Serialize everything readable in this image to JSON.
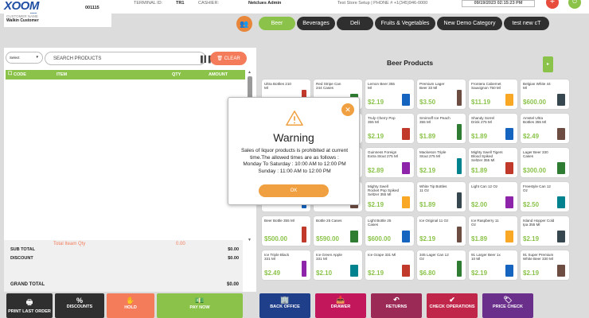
{
  "header": {
    "logo": "XOOM",
    "logo_sub": "POS",
    "register_label": "",
    "register": "001115",
    "terminal_label": "TERMINAL ID:",
    "terminal": "TR1",
    "cashier_label": "CASHIER:",
    "cashier": "Netclues Admin",
    "store": "Test Store Setup | PHONE # +1(345)946-0000",
    "datetime": "09/19/2023 02:15:23 PM"
  },
  "customer": {
    "label": "CUSTOMER NAME",
    "name": "Walkin Customer"
  },
  "categories": [
    {
      "label": "Beer",
      "active": true
    },
    {
      "label": "Beverages",
      "active": false
    },
    {
      "label": "Deli",
      "active": false
    },
    {
      "label": "Fruits & Vegetables",
      "active": false
    },
    {
      "label": "New Demo Category",
      "active": false
    },
    {
      "label": "test new cT",
      "active": false
    }
  ],
  "cart": {
    "select_label": "Select",
    "search_placeholder": "SEARCH PRODUCTS",
    "clear_label": "CLEAR",
    "columns": [
      "CODE",
      "ITEM",
      "QTY",
      "AMOUNT"
    ],
    "total_item_qty_label": "Total Iteam Qty",
    "total_item_qty": "0.00",
    "sub_total_label": "SUB TOTAL",
    "sub_total": "$0.00",
    "discount_label": "DISCOUNT",
    "discount": "$0.00",
    "grand_total_label": "GRAND TOTAL",
    "grand_total": "$0.00"
  },
  "actions": {
    "print_last_order": "PRINT LAST ORDER",
    "discounts": "DISCOUNTS",
    "hold": "HOLD",
    "pay_now": "PAY NOW"
  },
  "products_title": "Beer Products",
  "products": [
    {
      "name": "Ultra Bottles 210 Ml",
      "price": ""
    },
    {
      "name": "Red Stripe Can 244 Cases",
      "price": ""
    },
    {
      "name": "Lemon Beer 355 Ml",
      "price": "$2.19"
    },
    {
      "name": "Premium Lager Beer 33 Ml",
      "price": "$3.50"
    },
    {
      "name": "Frontera Cabernet Sauvignon 750 Ml",
      "price": "$11.19"
    },
    {
      "name": "Belgian White 44 Ml",
      "price": "$600.00"
    },
    {
      "name": "",
      "price": ""
    },
    {
      "name": "",
      "price": ""
    },
    {
      "name": "Truly Cherry Pop 355 Ml",
      "price": "$2.19"
    },
    {
      "name": "Smirnoff Ice Peach 355 Ml",
      "price": "$1.89"
    },
    {
      "name": "Shandy Sorrel Drink 275 Ml",
      "price": "$1.89"
    },
    {
      "name": "Amstel Ultra Bottles 355 Ml",
      "price": "$2.49"
    },
    {
      "name": "",
      "price": ""
    },
    {
      "name": "",
      "price": ""
    },
    {
      "name": "Guinness Foreign Extra Stout 275 Ml",
      "price": "$2.89"
    },
    {
      "name": "Mackeson Triple Stout 275 Ml",
      "price": "$2.19"
    },
    {
      "name": "Mighty Swell Tigers Blood Spiked Seltzer 355 Ml",
      "price": "$1.89"
    },
    {
      "name": "Lager Beer 330 Cases",
      "price": "$300.00"
    },
    {
      "name": "",
      "price": ""
    },
    {
      "name": "",
      "price": ""
    },
    {
      "name": "Mighty Swell Rocket Pop Spiked Seltzer 355 Ml",
      "price": "$2.19"
    },
    {
      "name": "White Tip Bottles 11 Oz",
      "price": "$1.89"
    },
    {
      "name": "Light Can 12 Oz",
      "price": "$2.00"
    },
    {
      "name": "Freestyle Can 12 Oz",
      "price": "$2.50"
    },
    {
      "name": "Beer Bottle 355 Ml",
      "price": "$500.00"
    },
    {
      "name": "Bottle 25 Cases",
      "price": "$590.00"
    },
    {
      "name": "Light Bottle 25 Cases",
      "price": "$600.00"
    },
    {
      "name": "Ice Original 11 Oz",
      "price": "$2.19"
    },
    {
      "name": "Ice Raspberry 11 Oz",
      "price": "$1.89"
    },
    {
      "name": "Island Hopper Cold Ipa 355 Ml",
      "price": "$2.19"
    },
    {
      "name": "Ice Triple Black 331 Ml",
      "price": "$2.49"
    },
    {
      "name": "Ice Green Apple 331 Ml",
      "price": "$2.10"
    },
    {
      "name": "Ice Grape 331 Ml",
      "price": "$2.19"
    },
    {
      "name": "345 Lager Can 12 Oz",
      "price": "$6.80"
    },
    {
      "name": "91 Larger Beer 1x 10 Ml",
      "price": "$2.19"
    },
    {
      "name": "91 Super Premium White Beer 330 Ml",
      "price": "$2.19"
    }
  ],
  "bottom": {
    "back_office": "BACK OFFICE",
    "drawer": "DRAWER",
    "returns": "RETURNS",
    "check_operations": "CHECK OPERATIONS",
    "price_check": "PRICE CHECK"
  },
  "modal": {
    "title": "Warning",
    "line1": "Sales of liquor products is prohibited at current time.The allowed times are as follows :",
    "line2": "Monday To Saturday : 10:00 AM to 12:00 PM",
    "line3": "Sunday : 11:00 AM to 12:00 PM",
    "ok": "OK"
  },
  "colors": {
    "green": "#8bc34a",
    "orange": "#f0a040",
    "coral": "#f47c5b",
    "dark": "#2f2f2f",
    "navy": "#1f4ea3"
  }
}
